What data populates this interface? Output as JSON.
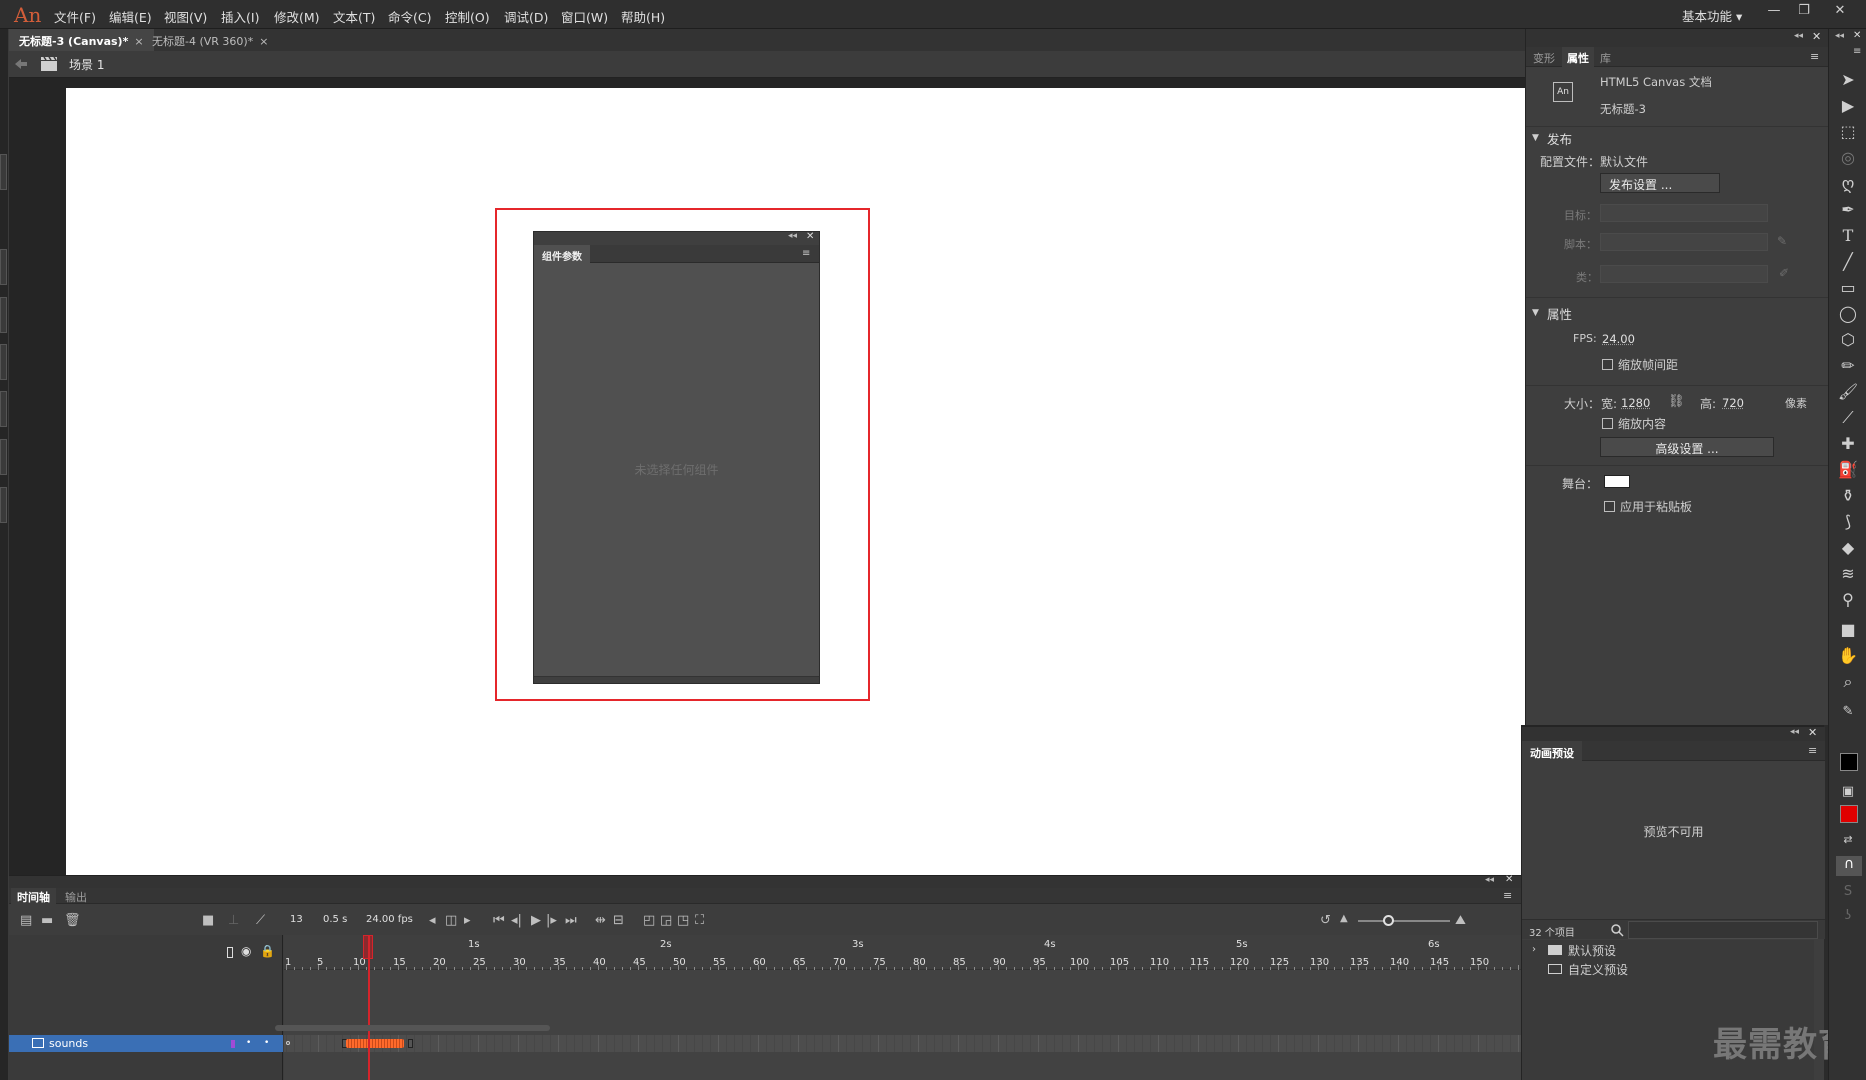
{
  "app": {
    "logo": "An",
    "menu": [
      "文件(F)",
      "编辑(E)",
      "视图(V)",
      "插入(I)",
      "修改(M)",
      "文本(T)",
      "命令(C)",
      "控制(O)",
      "调试(D)",
      "窗口(W)",
      "帮助(H)"
    ],
    "workspace": "基本功能 ▾",
    "win_min": "—",
    "win_restore": "❐",
    "win_close": "✕"
  },
  "doc_tabs": [
    {
      "label": "无标题-3 (Canvas)*",
      "close": "×"
    },
    {
      "label": "无标题-4 (VR 360)*",
      "close": "×"
    }
  ],
  "editbar": {
    "scene": "场景 1"
  },
  "component_panel": {
    "tab": "组件参数",
    "empty_message": "未选择任何组件"
  },
  "properties": {
    "tabs": [
      "变形",
      "属性",
      "库"
    ],
    "doc_icon": "An",
    "doc_type": "HTML5 Canvas 文档",
    "doc_name": "无标题-3",
    "publish": {
      "section": "发布",
      "profile_label": "配置文件：",
      "profile_value": "默认文件",
      "settings_button": "发布设置 ...",
      "target_label": "目标：",
      "script_label": "脚本：",
      "class_label": "类："
    },
    "attributes": {
      "section": "属性",
      "fps_label": "FPS:",
      "fps_value": "24.00",
      "scale_spans": "缩放帧间距",
      "size_label": "大小：",
      "width_label": "宽:",
      "width_value": "1280",
      "height_label": "高:",
      "height_value": "720",
      "unit": "像素",
      "scale_content": "缩放内容",
      "advanced_button": "高级设置 ...",
      "stage_label": "舞台：",
      "stage_color": "#ffffff",
      "apply_pasteboard": "应用于粘贴板"
    }
  },
  "presets": {
    "tab": "动画预设",
    "preview_text": "预览不可用",
    "count": "32 个项目",
    "folders": [
      "默认预设",
      "自定义预设"
    ]
  },
  "timeline": {
    "tabs": [
      "时间轴",
      "输出"
    ],
    "current_frame": "13",
    "elapsed": "0.5 s",
    "fps": "24.00 fps",
    "layer_name": "sounds",
    "seconds": [
      "1s",
      "2s",
      "3s",
      "4s",
      "5s",
      "6s"
    ],
    "frames": [
      "1",
      "5",
      "10",
      "15",
      "20",
      "25",
      "30",
      "35",
      "40",
      "45",
      "50",
      "55",
      "60",
      "65",
      "70",
      "75",
      "80",
      "85",
      "90",
      "95",
      "100",
      "105",
      "110",
      "115",
      "120",
      "125",
      "130",
      "135",
      "140",
      "145",
      "150"
    ]
  },
  "watermark": "最需教育",
  "colors": {
    "accent_red": "#e5262b",
    "selection_blue": "#3a6fb5",
    "waveform": "#ff6a2b"
  }
}
